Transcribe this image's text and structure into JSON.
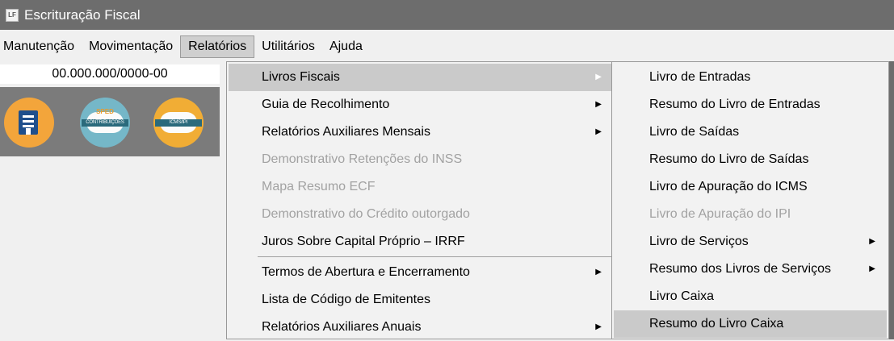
{
  "window": {
    "title": "Escrituração Fiscal",
    "icon_text": "LF"
  },
  "menubar": {
    "items": [
      "Manutenção",
      "Movimentação",
      "Relatórios",
      "Utilitários",
      "Ajuda"
    ],
    "active_index": 2
  },
  "company": {
    "cnpj": "00.000.000/0000-00"
  },
  "toolbar": {
    "buttons": [
      {
        "name": "building-icon"
      },
      {
        "name": "sped-contribuicoes-icon",
        "top_text": "SPED",
        "banner": "CONTRIBUIÇÕES"
      },
      {
        "name": "icms-ipi-icon",
        "banner": "ICMS/IPI"
      }
    ]
  },
  "relatorios_menu": {
    "items": [
      {
        "label": "Livros Fiscais",
        "submenu": true,
        "state": "hover"
      },
      {
        "label": "Guia de Recolhimento",
        "submenu": true
      },
      {
        "label": "Relatórios Auxiliares Mensais",
        "submenu": true
      },
      {
        "label": "Demonstrativo Retenções do INSS",
        "state": "disabled"
      },
      {
        "label": "Mapa Resumo ECF",
        "state": "disabled"
      },
      {
        "label": "Demonstrativo do Crédito outorgado",
        "state": "disabled"
      },
      {
        "label": "Juros Sobre Capital Próprio – IRRF"
      },
      {
        "label": "Termos de Abertura e Encerramento",
        "submenu": true
      },
      {
        "label": "Lista de Código de Emitentes"
      },
      {
        "label": "Relatórios Auxiliares Anuais",
        "submenu": true
      }
    ]
  },
  "livros_fiscais_submenu": {
    "items": [
      {
        "label": "Livro de Entradas"
      },
      {
        "label": "Resumo do Livro de Entradas"
      },
      {
        "label": "Livro de Saídas"
      },
      {
        "label": "Resumo do Livro de Saídas"
      },
      {
        "label": "Livro de Apuração do ICMS"
      },
      {
        "label": "Livro de Apuração do IPI",
        "state": "disabled"
      },
      {
        "label": "Livro de Serviços",
        "submenu": true
      },
      {
        "label": "Resumo dos Livros de Serviços",
        "submenu": true
      },
      {
        "label": "Livro Caixa"
      },
      {
        "label": "Resumo do Livro Caixa",
        "state": "hover"
      }
    ]
  },
  "arrow_glyph": "▶"
}
